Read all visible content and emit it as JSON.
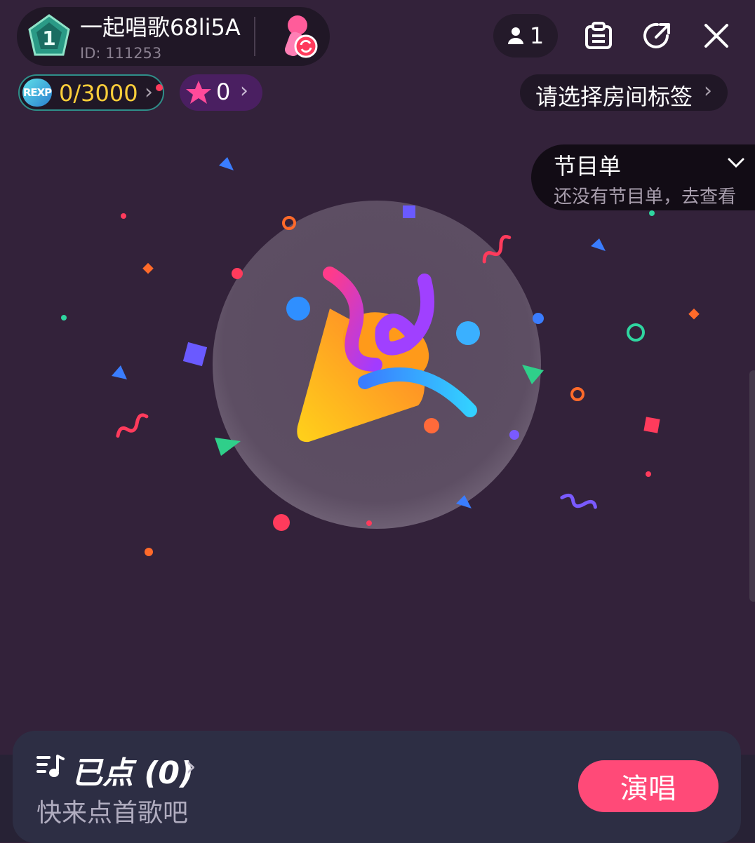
{
  "room": {
    "level": "1",
    "title": "一起唱歌68li5A",
    "id_text": "ID: 111253"
  },
  "header": {
    "member_count": "1"
  },
  "stats": {
    "exp_badge": "REXP",
    "exp_text": "0/3000",
    "star_count": "0"
  },
  "tag": {
    "label": "请选择房间标签"
  },
  "program": {
    "title": "节目单",
    "subtitle": "还没有节目单，去查看"
  },
  "queue": {
    "title": "已点 (0)",
    "subtitle": "快来点首歌吧",
    "sing_button": "演唱"
  },
  "colors": {
    "background": "#33223a",
    "accent": "#ff4a78",
    "exp_text": "#ffcf3a"
  },
  "icons": [
    "level-badge-icon",
    "microphone-switch-icon",
    "person-icon",
    "clipboard-icon",
    "share-icon",
    "close-icon",
    "star-icon",
    "chevron-right-icon",
    "chevron-down-icon",
    "music-queue-icon",
    "party-popper-icon"
  ]
}
